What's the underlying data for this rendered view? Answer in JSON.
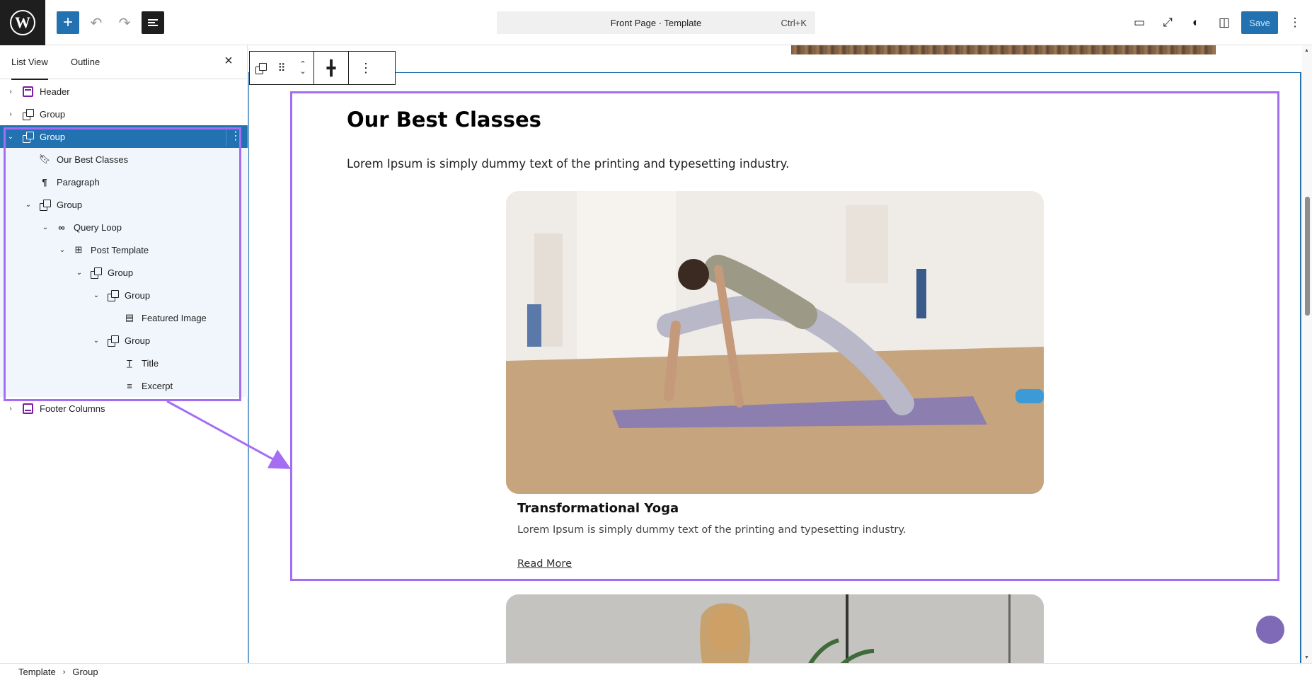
{
  "topbar": {
    "document_title": "Front Page · Template",
    "shortcut": "Ctrl+K",
    "save_label": "Save"
  },
  "sidebar": {
    "tabs": [
      {
        "label": "List View",
        "active": true
      },
      {
        "label": "Outline",
        "active": false
      }
    ],
    "tree": [
      {
        "label": "Header",
        "icon": "header-icon",
        "expanded": false
      },
      {
        "label": "Group",
        "icon": "group-icon",
        "expanded": false
      },
      {
        "label": "Group",
        "icon": "group-icon",
        "expanded": true,
        "selected": true
      },
      {
        "label": "Our Best Classes",
        "icon": "bookmark-icon"
      },
      {
        "label": "Paragraph",
        "icon": "paragraph-icon"
      },
      {
        "label": "Group",
        "icon": "group-icon",
        "expanded": true
      },
      {
        "label": "Query Loop",
        "icon": "loop-icon",
        "expanded": true
      },
      {
        "label": "Post Template",
        "icon": "layout-icon",
        "expanded": true
      },
      {
        "label": "Group",
        "icon": "group-icon",
        "expanded": true
      },
      {
        "label": "Group",
        "icon": "group-icon",
        "expanded": true
      },
      {
        "label": "Featured Image",
        "icon": "featured-image-icon"
      },
      {
        "label": "Group",
        "icon": "group-icon",
        "expanded": true
      },
      {
        "label": "Title",
        "icon": "title-icon"
      },
      {
        "label": "Excerpt",
        "icon": "excerpt-icon"
      },
      {
        "label": "Footer Columns",
        "icon": "footer-icon",
        "expanded": false
      }
    ]
  },
  "canvas": {
    "section_title": "Our Best Classes",
    "section_text": "Lorem Ipsum is simply dummy text of the printing and typesetting industry.",
    "card": {
      "title": "Transformational Yoga",
      "excerpt": "Lorem Ipsum is simply dummy text of the printing and typesetting industry.",
      "link": "Read More"
    }
  },
  "breadcrumb": {
    "items": [
      "Template",
      "Group"
    ]
  },
  "colors": {
    "accent": "#2271b1",
    "highlight": "#a56ef2",
    "block_icon": "#7b1fa2"
  }
}
